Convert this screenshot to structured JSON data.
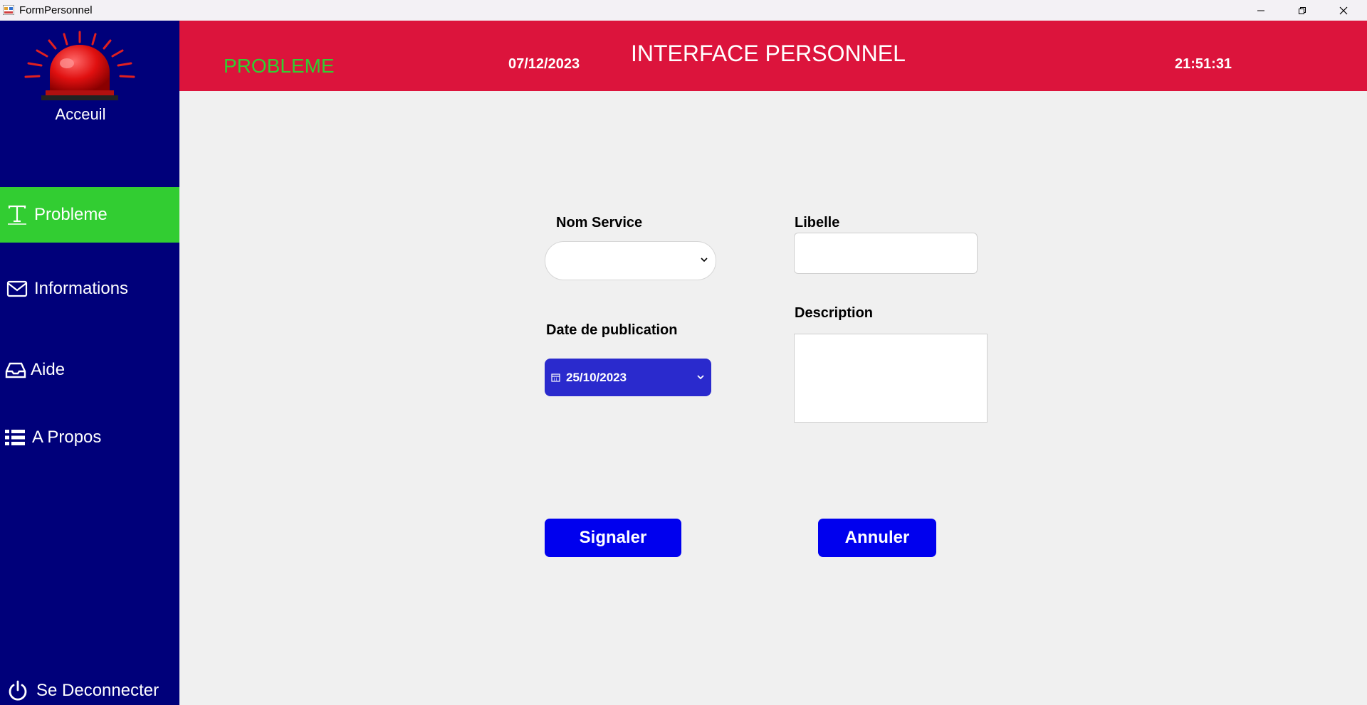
{
  "window": {
    "title": "FormPersonnel",
    "icons": [
      "app-icon",
      "minimize-icon",
      "restore-icon",
      "close-icon"
    ]
  },
  "sidebar": {
    "home_label": "Acceuil",
    "items": [
      {
        "label": "Probleme",
        "icon": "text-icon",
        "active": true
      },
      {
        "label": "Informations",
        "icon": "mail-icon",
        "active": false
      },
      {
        "label": "Aide",
        "icon": "inbox-icon",
        "active": false
      },
      {
        "label": "A Propos",
        "icon": "list-icon",
        "active": false
      }
    ],
    "logout_label": "Se Deconnecter",
    "background": "#00007a",
    "active_color": "#32cd32"
  },
  "header": {
    "section": "PROBLEME",
    "date": "07/12/2023",
    "title": "INTERFACE PERSONNEL",
    "time": "21:51:31",
    "background": "#dc143c"
  },
  "form": {
    "nom_service_label": "Nom Service",
    "nom_service_value": "",
    "libelle_label": "Libelle",
    "libelle_value": "",
    "date_label": "Date de publication",
    "date_value": "25/10/2023",
    "description_label": "Description",
    "description_value": "",
    "submit_label": "Signaler",
    "cancel_label": "Annuler",
    "button_color": "#0000ee"
  }
}
